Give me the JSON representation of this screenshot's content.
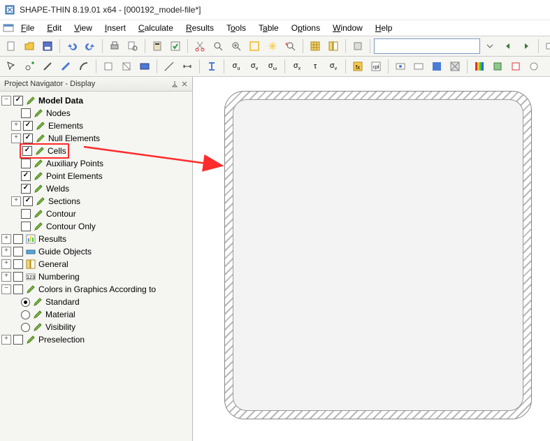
{
  "title": "SHAPE-THIN 8.19.01 x64 - [000192_model-file*]",
  "menu": [
    "File",
    "Edit",
    "View",
    "Insert",
    "Calculate",
    "Results",
    "Tools",
    "Table",
    "Options",
    "Window",
    "Help"
  ],
  "navigator_title": "Project Navigator - Display",
  "tree": {
    "model_data": "Model Data",
    "nodes": "Nodes",
    "elements": "Elements",
    "null_elements": "Null Elements",
    "cells": "Cells",
    "aux_points": "Auxiliary Points",
    "point_elements": "Point Elements",
    "welds": "Welds",
    "sections": "Sections",
    "contour": "Contour",
    "contour_only": "Contour Only",
    "results": "Results",
    "guide_objects": "Guide Objects",
    "general": "General",
    "numbering": "Numbering",
    "colors": "Colors in Graphics According to",
    "standard": "Standard",
    "material": "Material",
    "visibility": "Visibility",
    "preselection": "Preselection"
  }
}
